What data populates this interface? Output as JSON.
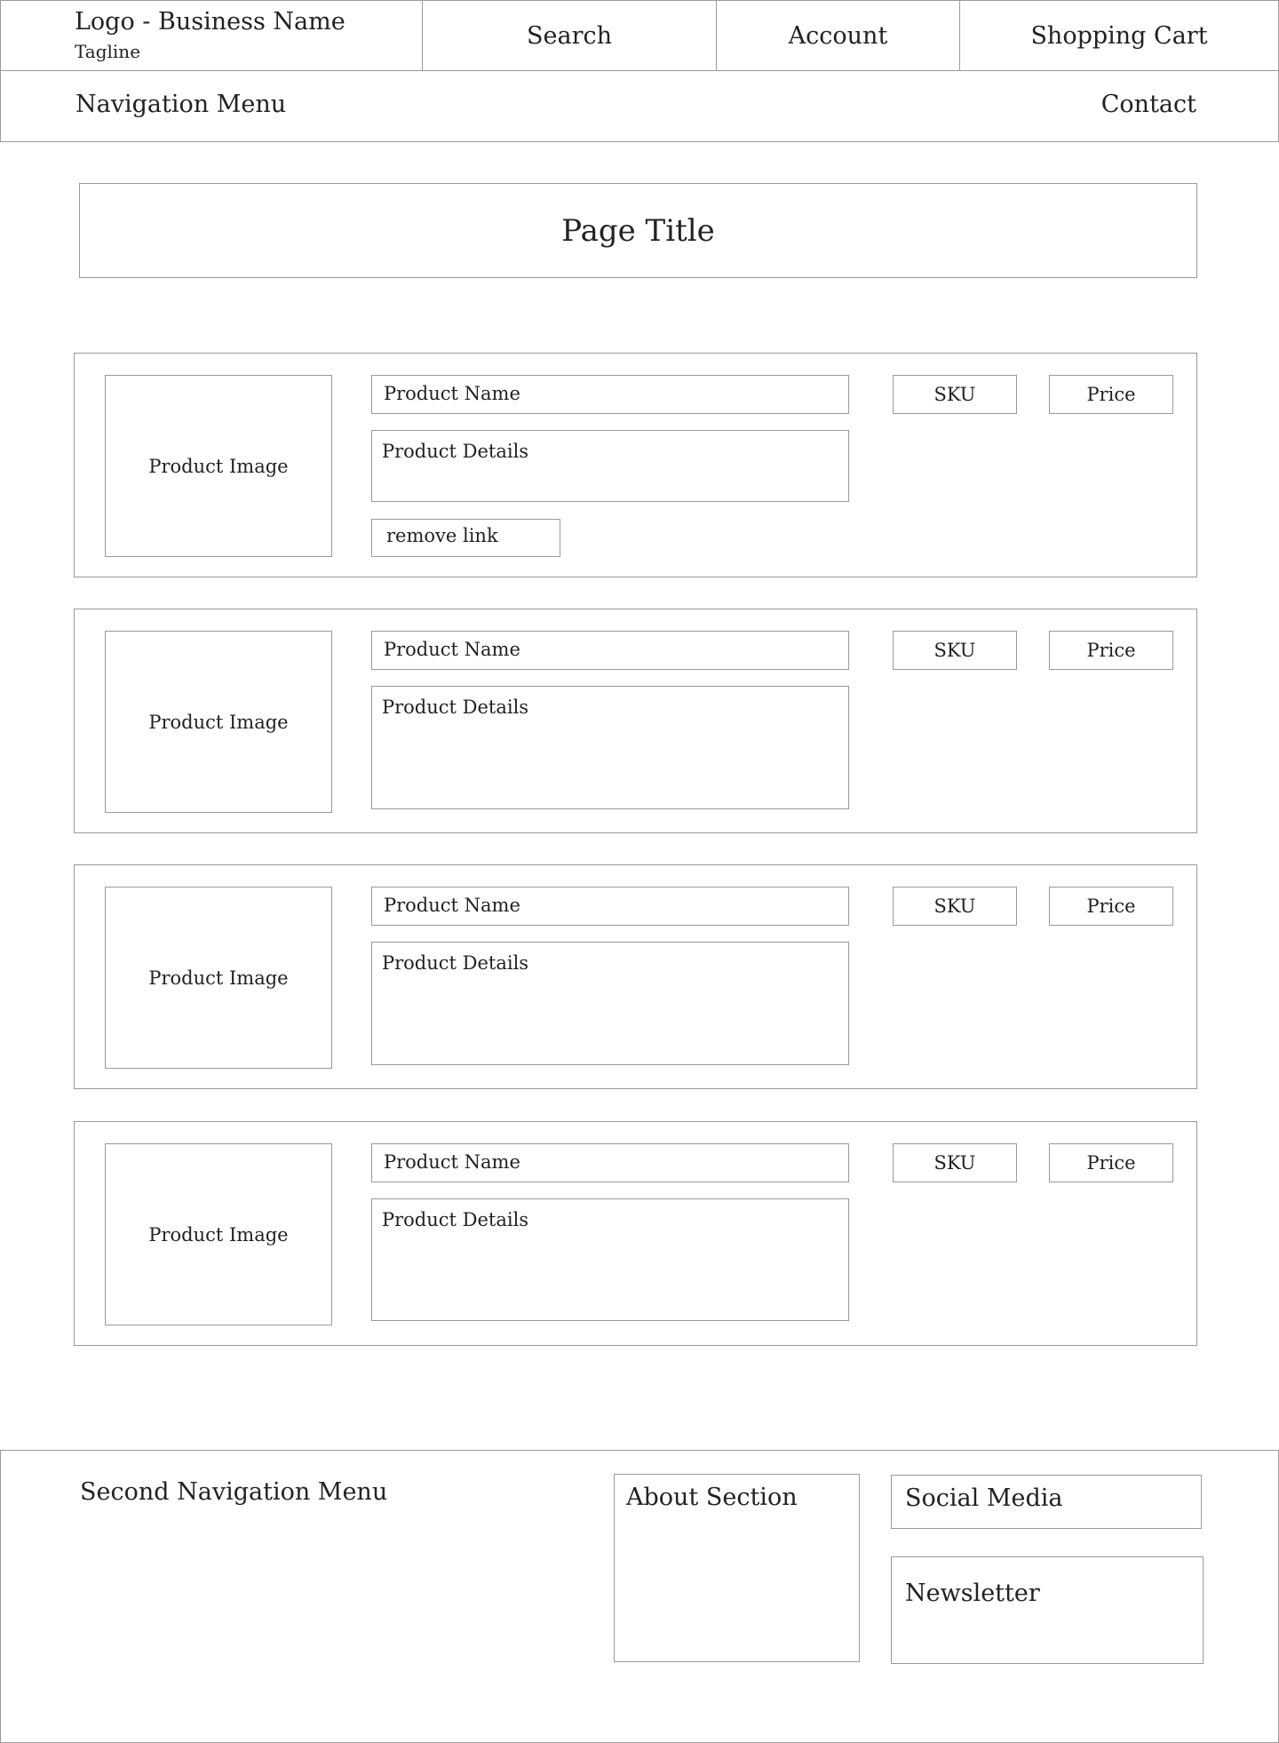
{
  "header": {
    "logo_text": "Logo - Business Name",
    "tagline": "Tagline",
    "search_label": "Search",
    "account_label": "Account",
    "cart_label": "Shopping Cart"
  },
  "nav": {
    "menu_label": "Navigation Menu",
    "contact_label": "Contact"
  },
  "page": {
    "title": "Page Title"
  },
  "products": [
    {
      "image_label": "Product Image",
      "name_label": "Product Name",
      "details_label": "Product Details",
      "sku_label": "SKU",
      "price_label": "Price",
      "remove_label": "remove link"
    },
    {
      "image_label": "Product Image",
      "name_label": "Product Name",
      "details_label": "Product Details",
      "sku_label": "SKU",
      "price_label": "Price"
    },
    {
      "image_label": "Product Image",
      "name_label": "Product Name",
      "details_label": "Product Details",
      "sku_label": "SKU",
      "price_label": "Price"
    },
    {
      "image_label": "Product Image",
      "name_label": "Product Name",
      "details_label": "Product Details",
      "sku_label": "SKU",
      "price_label": "Price"
    }
  ],
  "footer": {
    "second_nav_label": "Second Navigation Menu",
    "about_label": "About Section",
    "social_label": "Social Media",
    "newsletter_label": "Newsletter"
  }
}
